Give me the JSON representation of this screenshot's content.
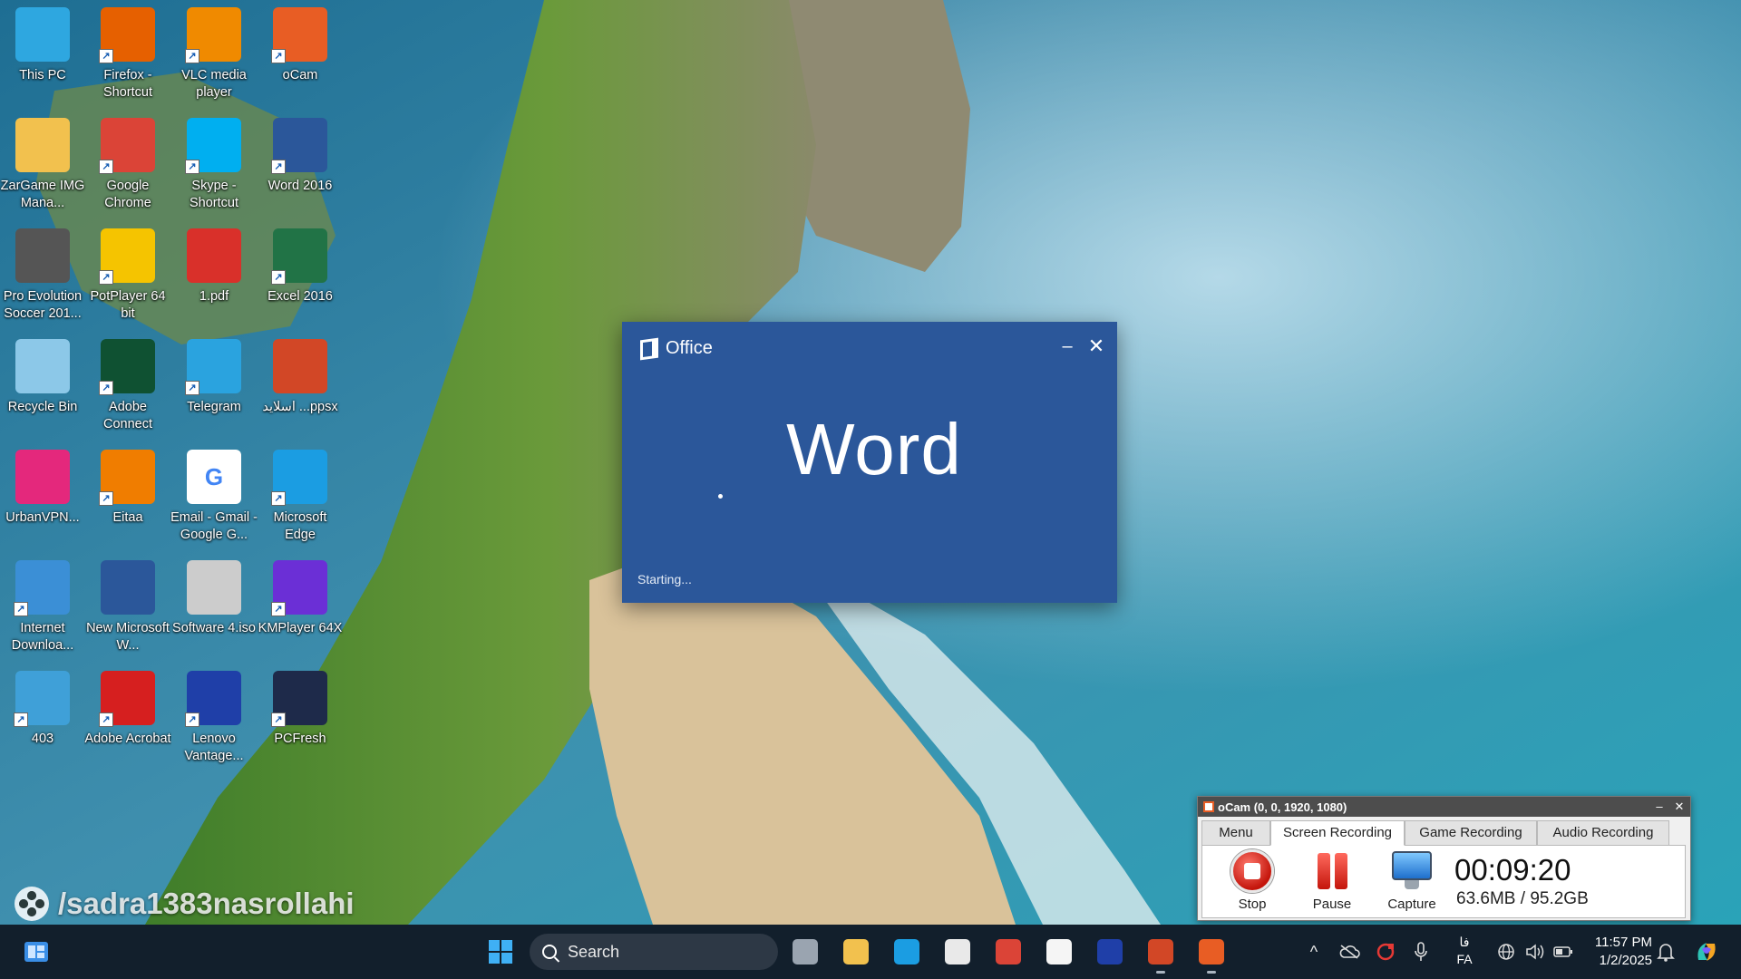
{
  "desktop": {
    "icons": [
      {
        "label": "This PC",
        "icon": "computer-icon",
        "shortcut": false,
        "color": "#2ea7e0"
      },
      {
        "label": "Firefox - Shortcut",
        "icon": "firefox-icon",
        "shortcut": true,
        "color": "#e66000"
      },
      {
        "label": "VLC media player",
        "icon": "vlc-icon",
        "shortcut": true,
        "color": "#f08a00"
      },
      {
        "label": "oCam",
        "icon": "ocam-icon",
        "shortcut": true,
        "color": "#e85d24"
      },
      {
        "label": "ZarGame IMG Mana...",
        "icon": "folder-icon",
        "shortcut": false,
        "color": "#f2c14e"
      },
      {
        "label": "Google Chrome",
        "icon": "chrome-icon",
        "shortcut": true,
        "color": "#db4437"
      },
      {
        "label": "Skype - Shortcut",
        "icon": "skype-icon",
        "shortcut": true,
        "color": "#00aff0"
      },
      {
        "label": "Word 2016",
        "icon": "word-icon",
        "shortcut": true,
        "color": "#2b579a"
      },
      {
        "label": "Pro Evolution Soccer 201...",
        "icon": "pes-gear-icon",
        "shortcut": false,
        "color": "#555555"
      },
      {
        "label": "PotPlayer 64 bit",
        "icon": "potplayer-icon",
        "shortcut": true,
        "color": "#f5c400"
      },
      {
        "label": "1.pdf",
        "icon": "pdf-icon",
        "shortcut": false,
        "color": "#d9302a"
      },
      {
        "label": "Excel 2016",
        "icon": "excel-icon",
        "shortcut": true,
        "color": "#217346"
      },
      {
        "label": "Recycle Bin",
        "icon": "recycle-bin-icon",
        "shortcut": false,
        "color": "#8cc8e8"
      },
      {
        "label": "Adobe Connect",
        "icon": "adobe-connect-icon",
        "shortcut": true,
        "color": "#0f5132"
      },
      {
        "label": "Telegram",
        "icon": "telegram-icon",
        "shortcut": true,
        "color": "#2aa3df"
      },
      {
        "label": "اسلاید ...ppsx",
        "icon": "powerpoint-show-icon",
        "shortcut": false,
        "color": "#d24726"
      },
      {
        "label": "UrbanVPN...",
        "icon": "urbanvpn-icon",
        "shortcut": false,
        "color": "#e4287c"
      },
      {
        "label": "Eitaa",
        "icon": "eitaa-icon",
        "shortcut": true,
        "color": "#f07d00"
      },
      {
        "label": "Email - Gmail - Google G...",
        "icon": "google-icon",
        "shortcut": false,
        "color": "#ffffff"
      },
      {
        "label": "Microsoft Edge",
        "icon": "edge-icon",
        "shortcut": true,
        "color": "#1b9de2"
      },
      {
        "label": "Internet Downloa...",
        "icon": "idm-icon",
        "shortcut": true,
        "color": "#3b8fd6"
      },
      {
        "label": "New Microsoft W...",
        "icon": "word-document-icon",
        "shortcut": false,
        "color": "#2b579a"
      },
      {
        "label": "Software 4.iso",
        "icon": "iso-disc-icon",
        "shortcut": false,
        "color": "#cccccc"
      },
      {
        "label": "KMPlayer 64X",
        "icon": "kmplayer-icon",
        "shortcut": true,
        "color": "#6b2fd6"
      },
      {
        "label": "403",
        "icon": "403-app-icon",
        "shortcut": true,
        "color": "#3fa0d8"
      },
      {
        "label": "Adobe Acrobat",
        "icon": "acrobat-icon",
        "shortcut": true,
        "color": "#d61f1f"
      },
      {
        "label": "Lenovo Vantage...",
        "icon": "lenovo-vantage-icon",
        "shortcut": true,
        "color": "#1f3fa8"
      },
      {
        "label": "PCFresh",
        "icon": "pcfresh-icon",
        "shortcut": true,
        "color": "#1e2a4a"
      }
    ],
    "watermark": "/sadra1383nasrollahi"
  },
  "splash": {
    "brand": "Office",
    "app_name": "Word",
    "status": "Starting...",
    "minimize_glyph": "–",
    "close_glyph": "✕",
    "background": "#2b579a"
  },
  "ocam": {
    "title": "oCam (0, 0, 1920, 1080)",
    "tabs": [
      "Menu",
      "Screen Recording",
      "Game Recording",
      "Audio Recording"
    ],
    "active_tab": "Screen Recording",
    "tools": {
      "stop": "Stop",
      "pause": "Pause",
      "capture": "Capture"
    },
    "elapsed": "00:09:20",
    "size": "63.6MB / 95.2GB"
  },
  "taskbar": {
    "search_placeholder": "Search",
    "pinned": [
      {
        "icon": "task-view-icon",
        "running": false
      },
      {
        "icon": "file-explorer-icon",
        "running": false
      },
      {
        "icon": "edge-icon",
        "running": false
      },
      {
        "icon": "microsoft-store-icon",
        "running": false
      },
      {
        "icon": "chrome-icon",
        "running": false
      },
      {
        "icon": "notepad-file-icon",
        "running": false
      },
      {
        "icon": "lenovo-vantage-icon",
        "running": false
      },
      {
        "icon": "powerpoint-icon",
        "running": true
      },
      {
        "icon": "ocam-icon",
        "running": true
      }
    ],
    "language": "FA",
    "language_secondary": "فا",
    "time": "11:57 PM",
    "date": "1/2/2025"
  }
}
